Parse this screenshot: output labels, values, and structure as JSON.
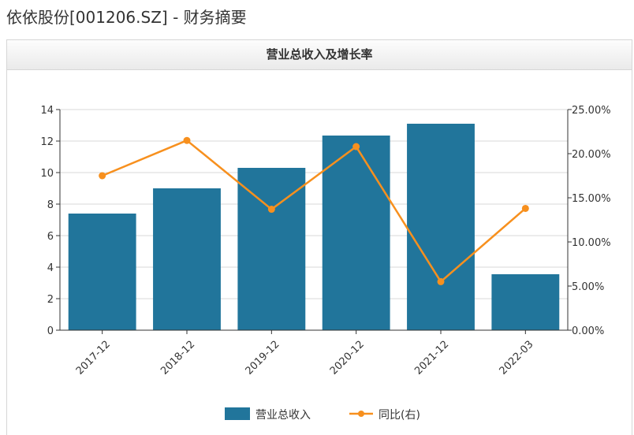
{
  "page": {
    "title": "依依股份[001206.SZ] - 财务摘要"
  },
  "panel": {
    "title": "营业总收入及增长率"
  },
  "colors": {
    "bar": "#21759b",
    "line": "#f7901e",
    "grid": "#d8d8d8",
    "axis": "#333333"
  },
  "chart_data": {
    "type": "bar",
    "title": "营业总收入及增长率",
    "categories": [
      "2017-12",
      "2018-12",
      "2019-12",
      "2020-12",
      "2021-12",
      "2022-03"
    ],
    "series": [
      {
        "name": "营业总收入",
        "type": "bar",
        "axis": "left",
        "values": [
          7.4,
          9.0,
          10.3,
          12.35,
          13.1,
          3.55
        ]
      },
      {
        "name": "同比(右)",
        "type": "line",
        "axis": "right",
        "values": [
          17.5,
          21.5,
          13.7,
          20.8,
          5.5,
          13.8
        ]
      }
    ],
    "y_left": {
      "ylim": [
        0,
        14
      ],
      "ticks": [
        0,
        2,
        4,
        6,
        8,
        10,
        12,
        14
      ],
      "tick_labels": [
        "0",
        "2",
        "4",
        "6",
        "8",
        "10",
        "12",
        "14"
      ]
    },
    "y_right": {
      "ylim": [
        0,
        25
      ],
      "ticks": [
        0,
        5,
        10,
        15,
        20,
        25
      ],
      "tick_labels": [
        "0.00%",
        "5.00%",
        "10.00%",
        "15.00%",
        "20.00%",
        "25.00%"
      ]
    },
    "grid": true,
    "legend_position": "bottom-center",
    "legend": [
      "营业总收入",
      "同比(右)"
    ]
  }
}
